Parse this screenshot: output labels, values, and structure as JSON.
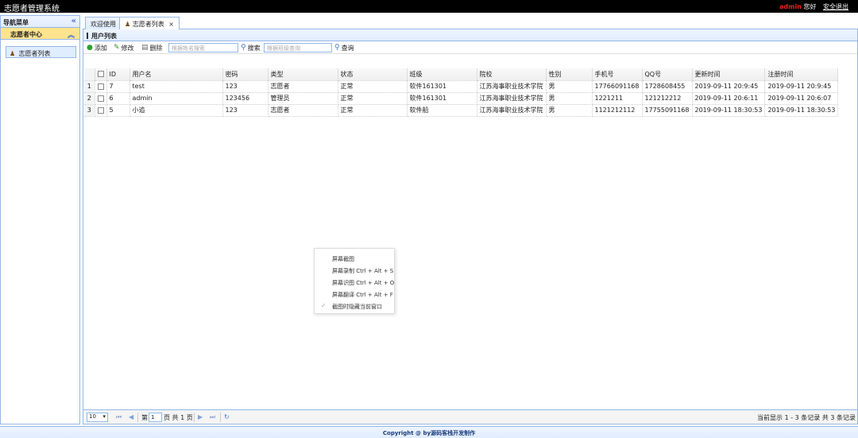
{
  "app": {
    "title": "志愿者管理系统"
  },
  "topbar": {
    "user": "admin",
    "greeting": "您好",
    "logout": "安全退出"
  },
  "sidebar": {
    "header": "导航菜单",
    "collapse_glyph": "«",
    "group": {
      "label": "志愿者中心",
      "chevron": "»"
    },
    "items": [
      {
        "label": "志愿者列表"
      }
    ]
  },
  "tabs": [
    {
      "label": "欢迎使用"
    },
    {
      "label": "志愿者列表",
      "close": "×"
    }
  ],
  "panel": {
    "title": "用户列表"
  },
  "toolbar": {
    "add": "添加",
    "edit": "修改",
    "delete": "删除",
    "name_search_placeholder": "根据姓名搜索",
    "search": "搜索",
    "class_search_placeholder": "根据班级查询",
    "query": "查询"
  },
  "table": {
    "columns": [
      "",
      "",
      "ID",
      "用户名",
      "密码",
      "类型",
      "状态",
      "班级",
      "院校",
      "性别",
      "手机号",
      "QQ号",
      "更新时间",
      "注册时间"
    ],
    "rows": [
      [
        "1",
        "7",
        "test",
        "123",
        "志愿者",
        "正常",
        "软件161301",
        "江苏海事职业技术学院",
        "男",
        "17766091168",
        "1728608455",
        "2019-09-11 20:9:45",
        "2019-09-11 20:9:45"
      ],
      [
        "2",
        "6",
        "admin",
        "123456",
        "管理员",
        "正常",
        "软件161301",
        "江苏海事职业技术学院",
        "男",
        "1221211",
        "121212212",
        "2019-09-11 20:6:11",
        "2019-09-11 20:6:07"
      ],
      [
        "3",
        "5",
        "小追",
        "123",
        "志愿者",
        "正常",
        "软件船",
        "江苏海事职业技术学院",
        "男",
        "1121212112",
        "17755091168",
        "2019-09-11 18:30:53",
        "2019-09-11 18:30:53"
      ]
    ]
  },
  "pager": {
    "page_size": "10",
    "page_prefix": "第",
    "page_value": "1",
    "page_suffix": "页 共 1 页",
    "info": "当前显示 1 - 3 条记录 共 3 条记录"
  },
  "context_menu": {
    "items": [
      "屏幕截图",
      "屏幕录制 Ctrl + Alt + S",
      "屏幕识图 Ctrl + Alt + O",
      "屏幕翻译 Ctrl + Alt + F",
      "截图时隐藏当前窗口"
    ]
  },
  "footer": {
    "text": "Copyright @ by源码客栈开发制作"
  },
  "colors": {
    "border": "#95b8e7",
    "header_bg": "#e0ecff",
    "group_bg": "#ffe48d",
    "user": "#e8251f"
  },
  "icons": [
    "plus-circle-icon",
    "pencil-icon",
    "trash-icon",
    "search-icon",
    "user-icon",
    "first-page-icon",
    "prev-page-icon",
    "next-page-icon",
    "last-page-icon",
    "refresh-icon",
    "check-icon"
  ]
}
